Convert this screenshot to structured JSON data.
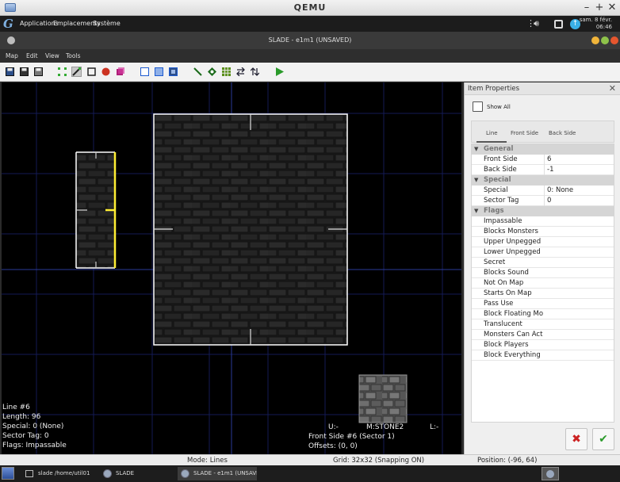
{
  "qemu": {
    "title": "QEMU",
    "minimize": "–",
    "maximize": "+",
    "close": "✕"
  },
  "top_panel": {
    "menus": [
      "Applications",
      "Emplacements",
      "Système"
    ],
    "clock_line1": "sam. 8 févr.",
    "clock_line2": "06:46"
  },
  "slade_window": {
    "title": "SLADE - e1m1 (UNSAVED)"
  },
  "menubar": {
    "items": [
      "Map",
      "Edit",
      "View",
      "Tools"
    ]
  },
  "toolbar": {
    "icons": [
      "save-icon",
      "save-all-icon",
      "save-as-icon",
      "vertices-mode-icon",
      "lines-mode-icon",
      "sectors-mode-icon",
      "things-mode-icon",
      "3d-mode-icon",
      "flat-icon",
      "textured-icon",
      "full-icon",
      "line-draw-icon",
      "vertex-diamond-icon",
      "grid-icon",
      "flip-horizontal-icon",
      "flip-vertical-icon",
      "play-icon"
    ],
    "selected": "lines-mode-icon"
  },
  "map": {
    "bottom_left_info": [
      "Line #6",
      "Length: 96",
      "Special: 0 (None)",
      "Sector Tag: 0",
      "Flags: Impassable"
    ],
    "front_side": {
      "u": "U:-",
      "texture_middle": "M:STONE2",
      "l": "L:-",
      "label": "Front Side #6 (Sector 1)",
      "offsets": "Offsets: (0, 0)"
    }
  },
  "properties": {
    "title": "Item Properties",
    "close": "✕",
    "show_all": "Show All",
    "tabs": [
      "Line",
      "Front Side",
      "Back Side"
    ],
    "active_tab": "Line",
    "sections": [
      {
        "name": "General",
        "rows": [
          {
            "label": "Front Side",
            "value": "6"
          },
          {
            "label": "Back Side",
            "value": "-1"
          }
        ]
      },
      {
        "name": "Special",
        "rows": [
          {
            "label": "Special",
            "value": "0: None"
          },
          {
            "label": "Sector Tag",
            "value": "0"
          }
        ]
      },
      {
        "name": "Flags",
        "rows": [
          {
            "label": "Impassable",
            "checked": true
          },
          {
            "label": "Blocks Monsters",
            "checked": false
          },
          {
            "label": "Upper Unpegged",
            "checked": false
          },
          {
            "label": "Lower Unpegged",
            "checked": false
          },
          {
            "label": "Secret",
            "checked": false
          },
          {
            "label": "Blocks Sound",
            "checked": false
          },
          {
            "label": "Not On Map",
            "checked": false
          },
          {
            "label": "Starts On Map",
            "checked": false
          },
          {
            "label": "Pass Use",
            "checked": false
          },
          {
            "label": "Block Floating Monsters",
            "checked": false
          },
          {
            "label": "Translucent",
            "checked": false
          },
          {
            "label": "Monsters Can Activate",
            "checked": false
          },
          {
            "label": "Block Players",
            "checked": false
          },
          {
            "label": "Block Everything",
            "checked": false
          }
        ]
      }
    ],
    "discard_button": "✖",
    "apply_button": "✔"
  },
  "statusbar": {
    "mode": "Mode: Lines",
    "grid": "Grid: 32x32 (Snapping ON)",
    "position": "Position: (-96, 64)"
  },
  "taskbar": {
    "tasks": [
      {
        "label": "slade /home/util01",
        "active": false
      },
      {
        "label": "SLADE",
        "active": false
      },
      {
        "label": "SLADE - e1m1 (UNSAVED)",
        "active": true
      }
    ]
  },
  "colors": {
    "selected_line": "#ffee33",
    "map_line": "#ffffff",
    "grid": "#1a1f5c",
    "accent_red": "#cc2222",
    "accent_green": "#2a9a2a"
  }
}
